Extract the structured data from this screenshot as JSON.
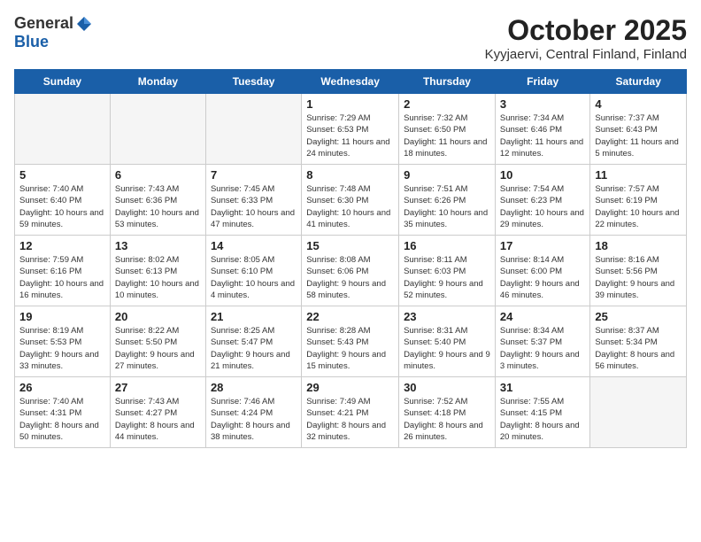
{
  "header": {
    "logo_general": "General",
    "logo_blue": "Blue",
    "month_title": "October 2025",
    "location": "Kyyjaervi, Central Finland, Finland"
  },
  "weekdays": [
    "Sunday",
    "Monday",
    "Tuesday",
    "Wednesday",
    "Thursday",
    "Friday",
    "Saturday"
  ],
  "weeks": [
    [
      {
        "day": "",
        "empty": true
      },
      {
        "day": "",
        "empty": true
      },
      {
        "day": "",
        "empty": true
      },
      {
        "day": "1",
        "sunrise": "Sunrise: 7:29 AM",
        "sunset": "Sunset: 6:53 PM",
        "daylight": "Daylight: 11 hours and 24 minutes."
      },
      {
        "day": "2",
        "sunrise": "Sunrise: 7:32 AM",
        "sunset": "Sunset: 6:50 PM",
        "daylight": "Daylight: 11 hours and 18 minutes."
      },
      {
        "day": "3",
        "sunrise": "Sunrise: 7:34 AM",
        "sunset": "Sunset: 6:46 PM",
        "daylight": "Daylight: 11 hours and 12 minutes."
      },
      {
        "day": "4",
        "sunrise": "Sunrise: 7:37 AM",
        "sunset": "Sunset: 6:43 PM",
        "daylight": "Daylight: 11 hours and 5 minutes."
      }
    ],
    [
      {
        "day": "5",
        "sunrise": "Sunrise: 7:40 AM",
        "sunset": "Sunset: 6:40 PM",
        "daylight": "Daylight: 10 hours and 59 minutes."
      },
      {
        "day": "6",
        "sunrise": "Sunrise: 7:43 AM",
        "sunset": "Sunset: 6:36 PM",
        "daylight": "Daylight: 10 hours and 53 minutes."
      },
      {
        "day": "7",
        "sunrise": "Sunrise: 7:45 AM",
        "sunset": "Sunset: 6:33 PM",
        "daylight": "Daylight: 10 hours and 47 minutes."
      },
      {
        "day": "8",
        "sunrise": "Sunrise: 7:48 AM",
        "sunset": "Sunset: 6:30 PM",
        "daylight": "Daylight: 10 hours and 41 minutes."
      },
      {
        "day": "9",
        "sunrise": "Sunrise: 7:51 AM",
        "sunset": "Sunset: 6:26 PM",
        "daylight": "Daylight: 10 hours and 35 minutes."
      },
      {
        "day": "10",
        "sunrise": "Sunrise: 7:54 AM",
        "sunset": "Sunset: 6:23 PM",
        "daylight": "Daylight: 10 hours and 29 minutes."
      },
      {
        "day": "11",
        "sunrise": "Sunrise: 7:57 AM",
        "sunset": "Sunset: 6:19 PM",
        "daylight": "Daylight: 10 hours and 22 minutes."
      }
    ],
    [
      {
        "day": "12",
        "sunrise": "Sunrise: 7:59 AM",
        "sunset": "Sunset: 6:16 PM",
        "daylight": "Daylight: 10 hours and 16 minutes."
      },
      {
        "day": "13",
        "sunrise": "Sunrise: 8:02 AM",
        "sunset": "Sunset: 6:13 PM",
        "daylight": "Daylight: 10 hours and 10 minutes."
      },
      {
        "day": "14",
        "sunrise": "Sunrise: 8:05 AM",
        "sunset": "Sunset: 6:10 PM",
        "daylight": "Daylight: 10 hours and 4 minutes."
      },
      {
        "day": "15",
        "sunrise": "Sunrise: 8:08 AM",
        "sunset": "Sunset: 6:06 PM",
        "daylight": "Daylight: 9 hours and 58 minutes."
      },
      {
        "day": "16",
        "sunrise": "Sunrise: 8:11 AM",
        "sunset": "Sunset: 6:03 PM",
        "daylight": "Daylight: 9 hours and 52 minutes."
      },
      {
        "day": "17",
        "sunrise": "Sunrise: 8:14 AM",
        "sunset": "Sunset: 6:00 PM",
        "daylight": "Daylight: 9 hours and 46 minutes."
      },
      {
        "day": "18",
        "sunrise": "Sunrise: 8:16 AM",
        "sunset": "Sunset: 5:56 PM",
        "daylight": "Daylight: 9 hours and 39 minutes."
      }
    ],
    [
      {
        "day": "19",
        "sunrise": "Sunrise: 8:19 AM",
        "sunset": "Sunset: 5:53 PM",
        "daylight": "Daylight: 9 hours and 33 minutes."
      },
      {
        "day": "20",
        "sunrise": "Sunrise: 8:22 AM",
        "sunset": "Sunset: 5:50 PM",
        "daylight": "Daylight: 9 hours and 27 minutes."
      },
      {
        "day": "21",
        "sunrise": "Sunrise: 8:25 AM",
        "sunset": "Sunset: 5:47 PM",
        "daylight": "Daylight: 9 hours and 21 minutes."
      },
      {
        "day": "22",
        "sunrise": "Sunrise: 8:28 AM",
        "sunset": "Sunset: 5:43 PM",
        "daylight": "Daylight: 9 hours and 15 minutes."
      },
      {
        "day": "23",
        "sunrise": "Sunrise: 8:31 AM",
        "sunset": "Sunset: 5:40 PM",
        "daylight": "Daylight: 9 hours and 9 minutes."
      },
      {
        "day": "24",
        "sunrise": "Sunrise: 8:34 AM",
        "sunset": "Sunset: 5:37 PM",
        "daylight": "Daylight: 9 hours and 3 minutes."
      },
      {
        "day": "25",
        "sunrise": "Sunrise: 8:37 AM",
        "sunset": "Sunset: 5:34 PM",
        "daylight": "Daylight: 8 hours and 56 minutes."
      }
    ],
    [
      {
        "day": "26",
        "sunrise": "Sunrise: 7:40 AM",
        "sunset": "Sunset: 4:31 PM",
        "daylight": "Daylight: 8 hours and 50 minutes."
      },
      {
        "day": "27",
        "sunrise": "Sunrise: 7:43 AM",
        "sunset": "Sunset: 4:27 PM",
        "daylight": "Daylight: 8 hours and 44 minutes."
      },
      {
        "day": "28",
        "sunrise": "Sunrise: 7:46 AM",
        "sunset": "Sunset: 4:24 PM",
        "daylight": "Daylight: 8 hours and 38 minutes."
      },
      {
        "day": "29",
        "sunrise": "Sunrise: 7:49 AM",
        "sunset": "Sunset: 4:21 PM",
        "daylight": "Daylight: 8 hours and 32 minutes."
      },
      {
        "day": "30",
        "sunrise": "Sunrise: 7:52 AM",
        "sunset": "Sunset: 4:18 PM",
        "daylight": "Daylight: 8 hours and 26 minutes."
      },
      {
        "day": "31",
        "sunrise": "Sunrise: 7:55 AM",
        "sunset": "Sunset: 4:15 PM",
        "daylight": "Daylight: 8 hours and 20 minutes."
      },
      {
        "day": "",
        "empty": true
      }
    ]
  ]
}
